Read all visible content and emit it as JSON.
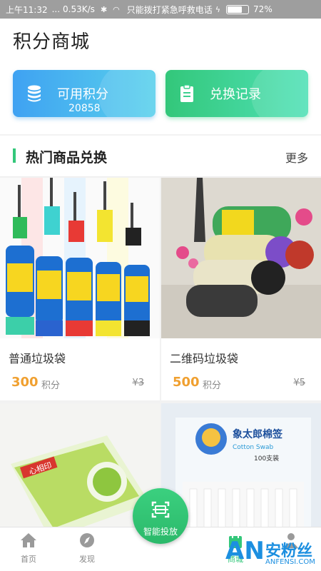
{
  "status_bar": {
    "time": "上午11:32",
    "separator": "...",
    "speed": "0.53K/s",
    "carrier": "只能拨打紧急呼救电话",
    "battery_percent_text": "72%",
    "battery_level": 0.72
  },
  "header": {
    "title": "积分商城"
  },
  "cards": {
    "points": {
      "label": "可用积分",
      "value": "20858",
      "icon": "coin-stack-icon"
    },
    "records": {
      "label": "兑换记录",
      "icon": "clipboard-icon"
    }
  },
  "section": {
    "title": "热门商品兑换",
    "more": "更多",
    "accent": "#33c77a"
  },
  "products": [
    {
      "name": "普通垃圾袋",
      "price": "300",
      "unit": "积分",
      "original": "¥3"
    },
    {
      "name": "二维码垃圾袋",
      "price": "500",
      "unit": "积分",
      "original": "¥5"
    },
    {
      "name": "",
      "price": "",
      "unit": "",
      "original": ""
    },
    {
      "name": "",
      "price": "",
      "unit": "",
      "original": ""
    }
  ],
  "product_images": {
    "p3_brand": "心相印",
    "p4_brand": "象太郎棉签",
    "p4_brand_en": "Cotton Swab",
    "p4_count": "100支装"
  },
  "nav": {
    "home": "首页",
    "discover": "发现",
    "fab": "智能投放",
    "mall": "商城"
  },
  "watermark": {
    "mark": "AN",
    "text": "安粉丝",
    "url": "ANFENSI.COM"
  },
  "colors": {
    "brand_green": "#33c77a",
    "brand_blue": "#3fa2f2",
    "price_orange": "#f0a030"
  }
}
